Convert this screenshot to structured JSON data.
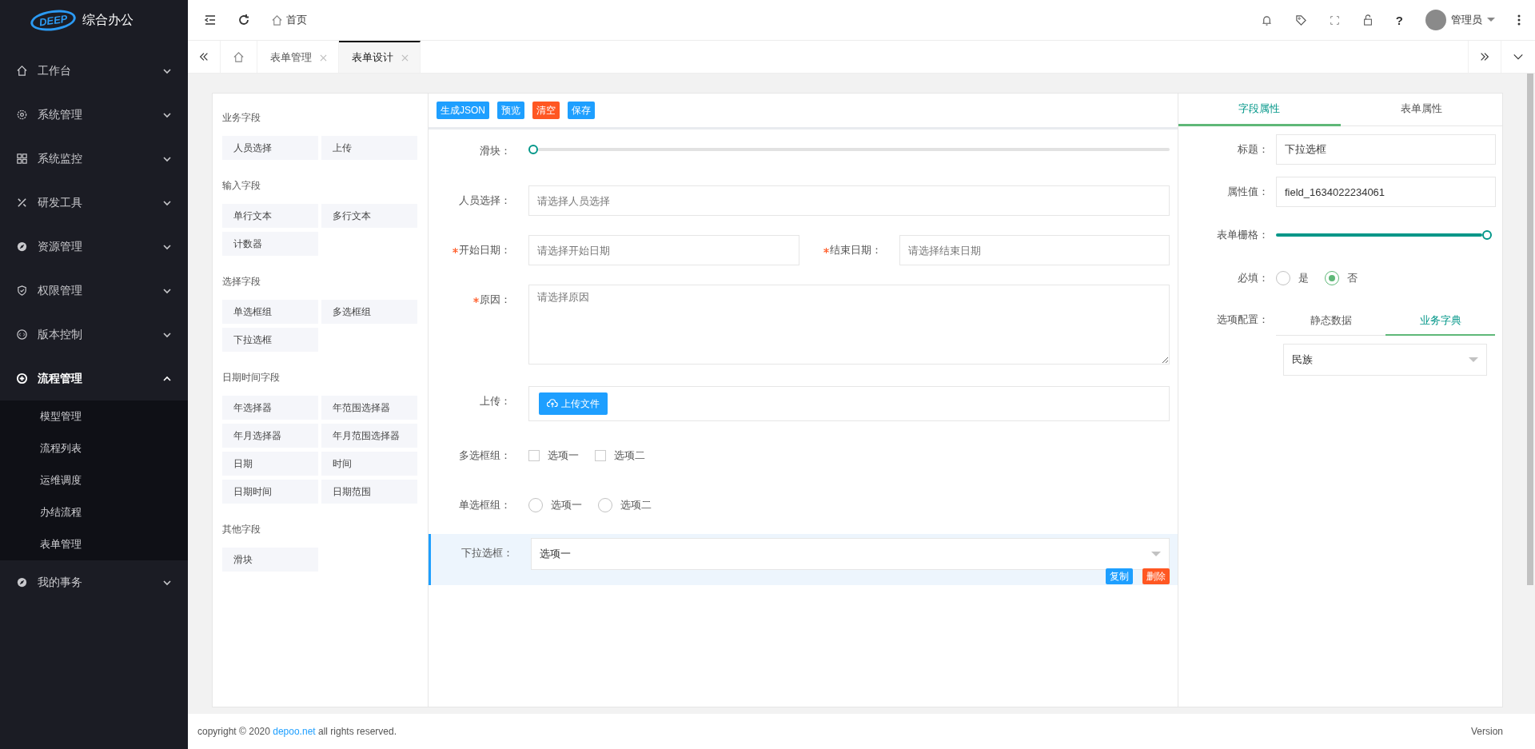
{
  "sidebar": {
    "logo_badge": "DEEP",
    "app_name": "综合办公",
    "items": [
      {
        "label": "工作台",
        "expanded": false
      },
      {
        "label": "系统管理",
        "expanded": false
      },
      {
        "label": "系统监控",
        "expanded": false
      },
      {
        "label": "研发工具",
        "expanded": false
      },
      {
        "label": "资源管理",
        "expanded": false
      },
      {
        "label": "权限管理",
        "expanded": false
      },
      {
        "label": "版本控制",
        "expanded": false
      },
      {
        "label": "流程管理",
        "expanded": true,
        "children": [
          {
            "label": "模型管理"
          },
          {
            "label": "流程列表"
          },
          {
            "label": "运维调度"
          },
          {
            "label": "办结流程"
          },
          {
            "label": "表单管理"
          }
        ]
      },
      {
        "label": "我的事务",
        "expanded": false
      }
    ]
  },
  "header": {
    "breadcrumb": "首页",
    "help": "?",
    "user": "管理员"
  },
  "tabs": [
    {
      "label": "表单管理",
      "selected": false
    },
    {
      "label": "表单设计",
      "selected": true
    }
  ],
  "palette": [
    {
      "title": "业务字段",
      "items": [
        "人员选择",
        "上传"
      ]
    },
    {
      "title": "输入字段",
      "items": [
        "单行文本",
        "多行文本",
        "计数器"
      ]
    },
    {
      "title": "选择字段",
      "items": [
        "单选框组",
        "多选框组",
        "下拉选框"
      ]
    },
    {
      "title": "日期时间字段",
      "items": [
        "年选择器",
        "年范围选择器",
        "年月选择器",
        "年月范围选择器",
        "日期",
        "时间",
        "日期时间",
        "日期范围"
      ]
    },
    {
      "title": "其他字段",
      "items": [
        "滑块"
      ]
    }
  ],
  "toolbar": [
    {
      "label": "生成JSON",
      "kind": "primary"
    },
    {
      "label": "预览",
      "kind": "primary"
    },
    {
      "label": "清空",
      "kind": "danger"
    },
    {
      "label": "保存",
      "kind": "primary"
    }
  ],
  "form": [
    {
      "kind": "slider",
      "label": "滑块：",
      "required": false,
      "level": 0
    },
    {
      "kind": "input",
      "label": "人员选择：",
      "required": false,
      "placeholder": "请选择人员选择"
    },
    {
      "kind": "pair",
      "items": [
        {
          "label": "开始日期：",
          "required": true,
          "placeholder": "请选择开始日期"
        },
        {
          "label": "结束日期：",
          "required": true,
          "placeholder": "请选择结束日期"
        }
      ]
    },
    {
      "kind": "textarea",
      "label": "原因：",
      "required": true,
      "placeholder": "请选择原因"
    },
    {
      "kind": "upload",
      "label": "上传：",
      "required": false,
      "button": "上传文件"
    },
    {
      "kind": "checkbox",
      "label": "多选框组：",
      "required": false,
      "options": [
        {
          "label": "选项一",
          "checked": false
        },
        {
          "label": "选项二",
          "checked": false
        }
      ]
    },
    {
      "kind": "radio",
      "label": "单选框组：",
      "required": false,
      "options": [
        {
          "label": "选项一",
          "selected": false
        },
        {
          "label": "选项二",
          "selected": false
        }
      ]
    },
    {
      "kind": "select",
      "label": "下拉选框：",
      "required": false,
      "value": "选项一",
      "selected": true,
      "actions": [
        {
          "label": "复制",
          "kind": "primary"
        },
        {
          "label": "删除",
          "kind": "danger"
        }
      ]
    }
  ],
  "properties": {
    "tabs": [
      {
        "label": "字段属性",
        "selected": true
      },
      {
        "label": "表单属性",
        "selected": false
      }
    ],
    "title_label": "标题：",
    "title_value": "下拉选框",
    "key_label": "属性值：",
    "key_value": "field_1634022234061",
    "grid": {
      "label": "表单栅格：",
      "level": 1
    },
    "required_label": "必填：",
    "required_options": [
      {
        "label": "是",
        "selected": false
      },
      {
        "label": "否",
        "selected": true
      }
    ],
    "options_label": "选项配置：",
    "options_tabs": [
      {
        "label": "静态数据",
        "selected": false
      },
      {
        "label": "业务字典",
        "selected": true
      }
    ],
    "dictionary_value": "民族"
  },
  "footer": {
    "copyright": "copyright © 2020",
    "link": "depoo.net",
    "rights": "all rights reserved.",
    "version": "Version"
  }
}
